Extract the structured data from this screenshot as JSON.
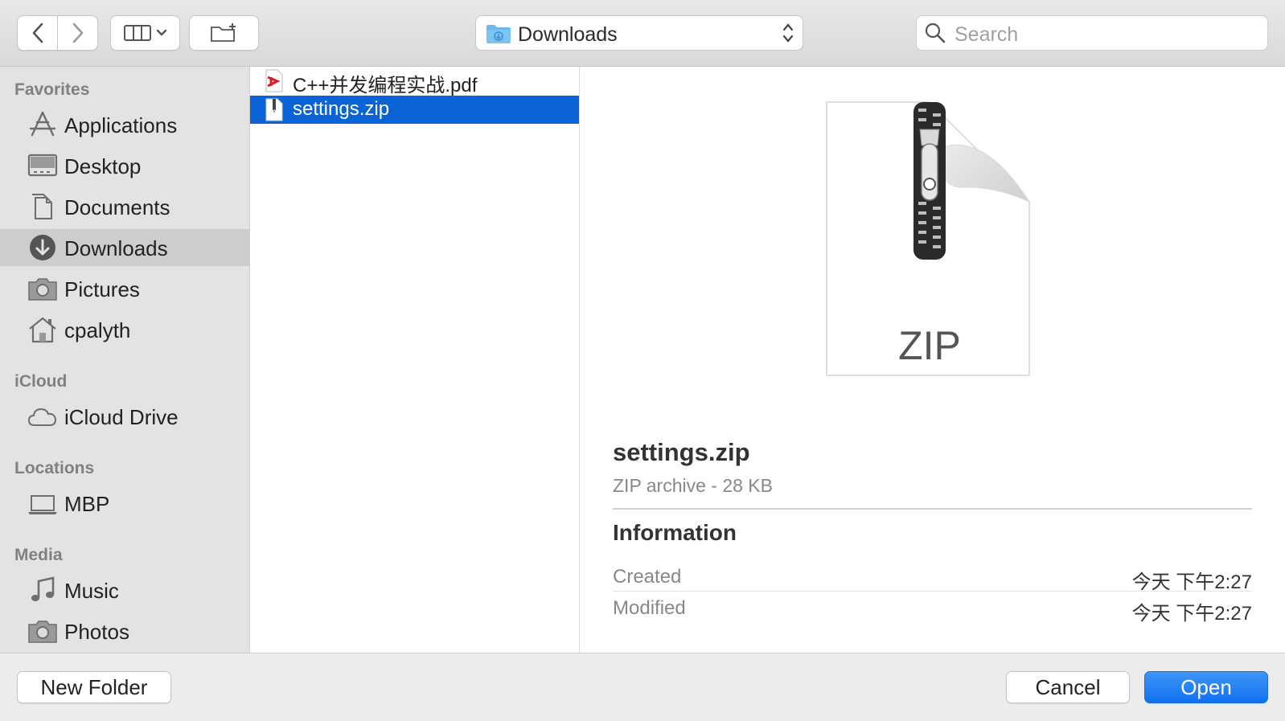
{
  "toolbar": {
    "back_icon": "chevron-left-icon",
    "forward_icon": "chevron-right-icon",
    "view_icon": "column-view-icon",
    "new_folder_icon": "new-folder-icon",
    "location_label": "Downloads",
    "search_placeholder": "Search"
  },
  "sidebar": {
    "favorites_title": "Favorites",
    "favorites": [
      {
        "label": "Applications",
        "icon": "applications-icon"
      },
      {
        "label": "Desktop",
        "icon": "desktop-icon"
      },
      {
        "label": "Documents",
        "icon": "documents-icon"
      },
      {
        "label": "Downloads",
        "icon": "downloads-icon",
        "selected": true
      },
      {
        "label": "Pictures",
        "icon": "pictures-icon"
      },
      {
        "label": "cpalyth",
        "icon": "home-icon"
      }
    ],
    "icloud_title": "iCloud",
    "icloud": [
      {
        "label": "iCloud Drive",
        "icon": "cloud-icon"
      }
    ],
    "locations_title": "Locations",
    "locations": [
      {
        "label": "MBP",
        "icon": "laptop-icon"
      }
    ],
    "media_title": "Media",
    "media": [
      {
        "label": "Music",
        "icon": "music-icon"
      },
      {
        "label": "Photos",
        "icon": "photos-icon"
      }
    ]
  },
  "files": [
    {
      "name": "C++并发编程实战.pdf",
      "icon": "pdf-file-icon"
    },
    {
      "name": "settings.zip",
      "icon": "zip-file-icon",
      "selected": true
    }
  ],
  "preview": {
    "icon_label": "ZIP",
    "name": "settings.zip",
    "kind": "ZIP archive - 28 KB",
    "info_title": "Information",
    "created_label": "Created",
    "created_value": "今天 下午2:27",
    "modified_label": "Modified",
    "modified_value": "今天 下午2:27"
  },
  "bottom": {
    "new_folder_label": "New Folder",
    "cancel_label": "Cancel",
    "open_label": "Open"
  },
  "colors": {
    "selection": "#0a64d8",
    "primary_button": "#1070ef",
    "folder_blue": "#6cb8f0"
  }
}
